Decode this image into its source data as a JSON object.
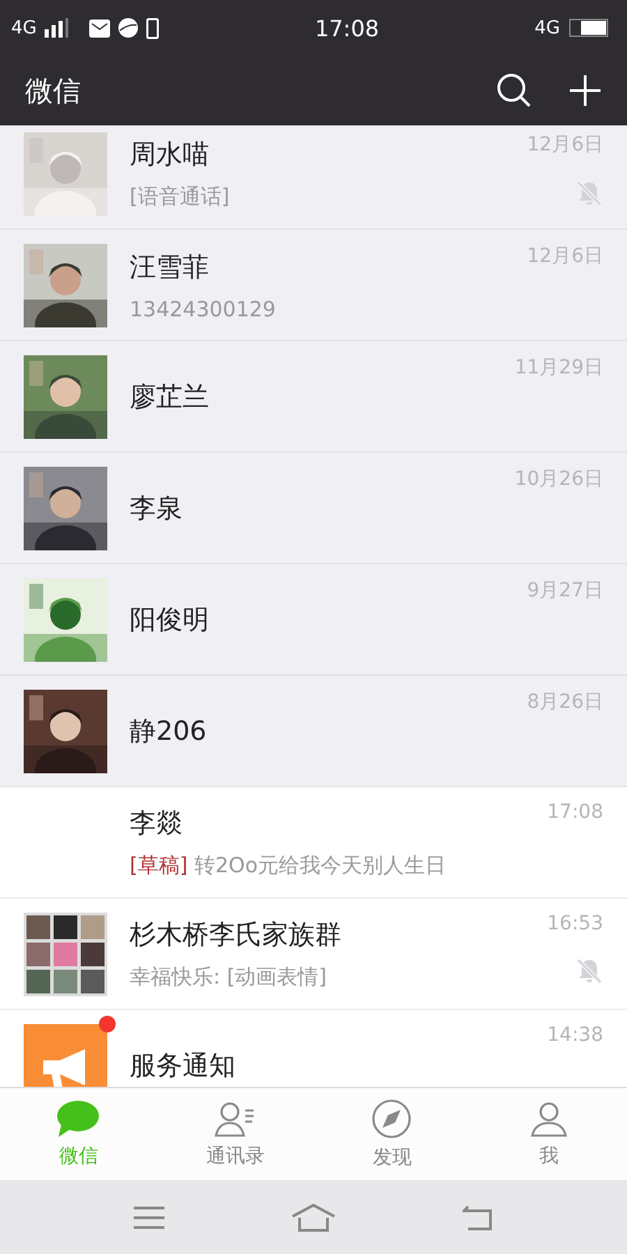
{
  "status_bar": {
    "network_left": "4G",
    "time": "17:08",
    "network_right": "4G"
  },
  "header": {
    "title": "微信"
  },
  "chats": [
    {
      "name": "周水喵",
      "preview": "[语音通话]",
      "time": "12月6日",
      "pinned": true,
      "muted": true,
      "kind": "picture"
    },
    {
      "name": "汪雪菲",
      "preview": "13424300129",
      "time": "12月6日",
      "pinned": true,
      "muted": false,
      "kind": "picture"
    },
    {
      "name": "廖芷兰",
      "time": "11月29日",
      "pinned": true,
      "muted": false,
      "kind": "picture"
    },
    {
      "name": "李泉",
      "time": "10月26日",
      "pinned": true,
      "muted": false,
      "kind": "picture"
    },
    {
      "name": "阳俊明",
      "time": "9月27日",
      "pinned": true,
      "muted": false,
      "kind": "picture"
    },
    {
      "name": "静206",
      "time": "8月26日",
      "pinned": true,
      "muted": false,
      "kind": "picture"
    },
    {
      "name": "李燚",
      "draft_tag": "[草稿]",
      "preview": "转2Oo元给我今天别人生日",
      "time": "17:08",
      "pinned": false,
      "muted": false,
      "kind": "blank"
    },
    {
      "name": "杉木桥李氏家族群",
      "preview": "幸福快乐: [动画表情]",
      "time": "16:53",
      "pinned": false,
      "muted": true,
      "kind": "group"
    },
    {
      "name": "服务通知",
      "time": "14:38",
      "pinned": false,
      "muted": false,
      "kind": "notice",
      "unread_dot": true
    }
  ],
  "tabs": [
    {
      "label": "微信",
      "selected": true,
      "kind": "chat"
    },
    {
      "label": "通讯录",
      "selected": false,
      "kind": "contacts"
    },
    {
      "label": "发现",
      "selected": false,
      "kind": "compass"
    },
    {
      "label": "我",
      "selected": false,
      "kind": "me"
    }
  ]
}
